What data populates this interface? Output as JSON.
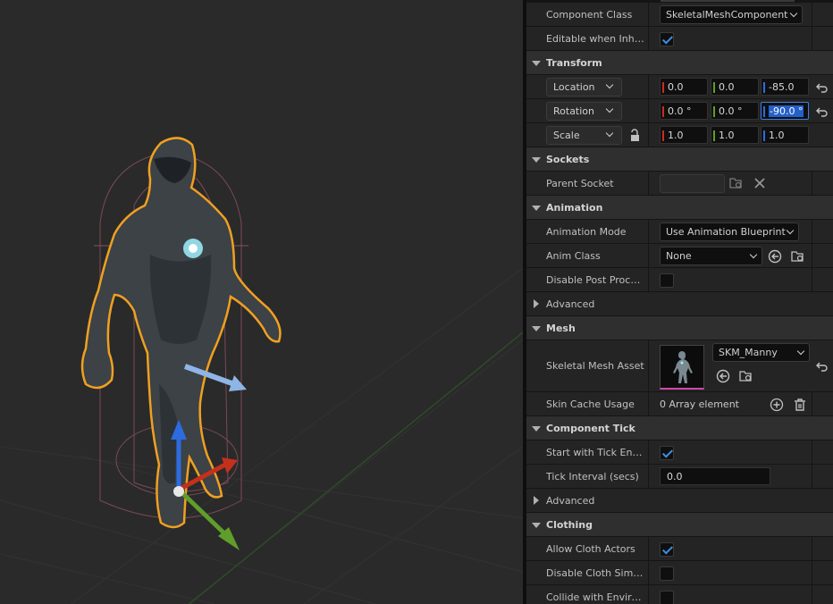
{
  "details": {
    "component_class": {
      "label": "Component Class",
      "value": "SkeletalMeshComponent"
    },
    "editable_inherited": {
      "label": "Editable when Inherit...",
      "checked": true
    },
    "transform": {
      "category": "Transform",
      "location": {
        "mode": "Location",
        "x": "0.0",
        "y": "0.0",
        "z": "-85.0"
      },
      "rotation": {
        "mode": "Rotation",
        "x": "0.0 °",
        "y": "0.0 °",
        "z": "-90.0 °"
      },
      "scale": {
        "mode": "Scale",
        "x": "1.0",
        "y": "1.0",
        "z": "1.0"
      }
    },
    "sockets": {
      "category": "Sockets",
      "parent_socket": {
        "label": "Parent Socket",
        "value": ""
      }
    },
    "animation": {
      "category": "Animation",
      "mode": {
        "label": "Animation Mode",
        "value": "Use Animation Blueprint"
      },
      "anim_class": {
        "label": "Anim Class",
        "value": "None"
      },
      "disable_post": {
        "label": "Disable Post Proces...",
        "checked": false
      },
      "advanced": "Advanced"
    },
    "mesh": {
      "category": "Mesh",
      "asset": {
        "label": "Skeletal Mesh Asset",
        "value": "SKM_Manny"
      },
      "skin_cache": {
        "label": "Skin Cache Usage",
        "value": "0 Array element"
      }
    },
    "component_tick": {
      "category": "Component Tick",
      "start_tick": {
        "label": "Start with Tick Enabl...",
        "checked": true
      },
      "tick_interval": {
        "label": "Tick Interval (secs)",
        "value": "0.0"
      },
      "advanced": "Advanced"
    },
    "clothing": {
      "category": "Clothing",
      "allow_cloth": {
        "label": "Allow Cloth Actors",
        "checked": true
      },
      "disable_cloth": {
        "label": "Disable Cloth Simula...",
        "checked": false
      },
      "collide_env": {
        "label": "Collide with Environ...",
        "checked": false
      }
    }
  },
  "colors": {
    "accent": "#3d8fe8",
    "axis_x": "#c4301c",
    "axis_y": "#5f9e2a",
    "axis_z": "#2d6be0",
    "selection_outline": "#f0a020"
  },
  "icons": [
    "checkbox-icon",
    "reset-arrow-icon",
    "lock-icon",
    "browse-folder-icon",
    "clear-x-icon",
    "use-selected-arrow-icon",
    "add-icon",
    "delete-icon"
  ]
}
